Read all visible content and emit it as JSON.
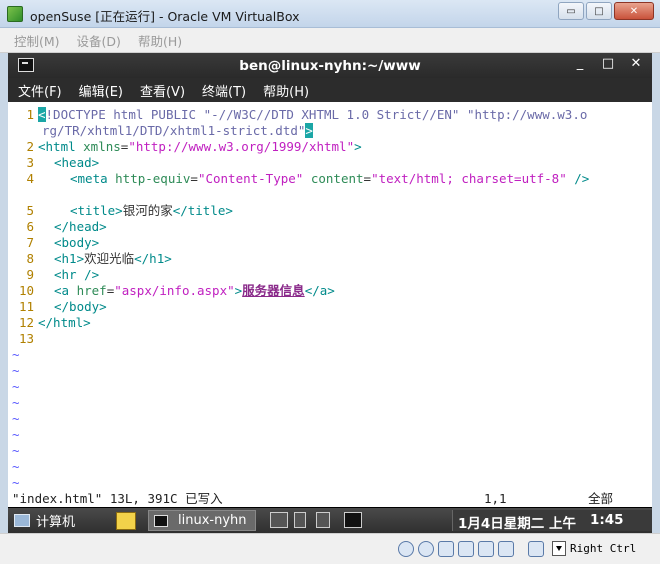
{
  "window": {
    "title": "openSuse [正在运行] - Oracle VM VirtualBox",
    "controls": {
      "minimize": "▭",
      "maximize": "□",
      "close": "✕"
    }
  },
  "vb_menu": [
    "控制(M)",
    "设备(D)",
    "帮助(H)"
  ],
  "terminal": {
    "title": "ben@linux-nyhn:~/www",
    "controls": {
      "minimize": "_",
      "maximize": "□",
      "close": "✕"
    },
    "menu": [
      "文件(F)",
      "编辑(E)",
      "查看(V)",
      "终端(T)",
      "帮助(H)"
    ]
  },
  "editor": {
    "line_numbers": [
      "1",
      "2",
      "3",
      "4",
      "5",
      "6",
      "7",
      "8",
      "9",
      "10",
      "11",
      "12",
      "13"
    ],
    "tilde": "~",
    "tokens": {
      "l1a": "<",
      "l1b": "!DOCTYPE html PUBLIC \"-//W3C//DTD XHTML 1.0 Strict//EN\" \"http://www.w3.o",
      "l1c": "rg/TR/xhtml1/DTD/xhtml1-strict.dtd\"",
      "l1d": ">",
      "l2a": "<html ",
      "l2b": "xmlns",
      "l2c": "=",
      "l2d": "\"http://www.w3.org/1999/xhtml\"",
      "l2e": ">",
      "l3": "<head>",
      "l4a": "<meta ",
      "l4b": "http-equiv",
      "l4c": "=",
      "l4d": "\"Content-Type\"",
      "l4e": " content",
      "l4f": "=",
      "l4g": "\"text/html; charset=utf-8\"",
      "l4h": " />",
      "l5a": "<title>",
      "l5b": "银河的家",
      "l5c": "</title>",
      "l6": "</head>",
      "l7": "<body>",
      "l8a": "<h1>",
      "l8b": "欢迎光临",
      "l8c": "</h1>",
      "l9": "<hr />",
      "l10a": "<a ",
      "l10b": "href",
      "l10c": "=",
      "l10d": "\"aspx/info.aspx\"",
      "l10e": ">",
      "l10f": "服务器信息",
      "l10g": "</a>",
      "l11": "</body>",
      "l12": "</html>"
    },
    "status": {
      "file_info": "\"index.html\" 13L, 391C 已写入",
      "position": "1,1",
      "scroll": "全部"
    }
  },
  "guest_taskbar": {
    "computer_label": "计算机",
    "task_label": "linux-nyhn",
    "clock_date": "1月4日星期二 上午",
    "clock_time": "1:45"
  },
  "vb_status": {
    "host_key": "Right Ctrl"
  },
  "colors": {
    "cursor": "#1ba6a6",
    "tag": "#008a8a",
    "string": "#c020c0",
    "attr": "#2e8b57",
    "line_number": "#b08000",
    "tilde": "#5a5aff"
  }
}
